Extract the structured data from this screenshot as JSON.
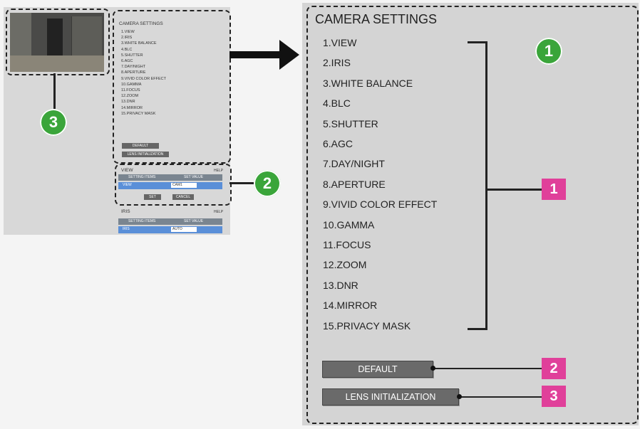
{
  "small_panel": {
    "title": "CAMERA SETTINGS",
    "menu_items": [
      "1.VIEW",
      "2.IRIS",
      "3.WHITE BALANCE",
      "4.BLC",
      "5.SHUTTER",
      "6.AGC",
      "7.DAY/NIGHT",
      "8.APERTURE",
      "9.VIVID COLOR EFFECT",
      "10.GAMMA",
      "11.FOCUS",
      "12.ZOOM",
      "13.DNR",
      "14.MIRROR",
      "15.PRIVACY MASK"
    ],
    "default_label": "DEFAULT",
    "lens_init_label": "LENS INITIALIZATION",
    "view_section": {
      "title": "VIEW",
      "help": "HELP",
      "col_item": "SETTING ITEMS",
      "col_value": "SET VALUE",
      "row_label": "VIEW",
      "row_value": "CAM1",
      "set_label": "SET",
      "cancel_label": "CANCEL"
    },
    "iris_section": {
      "title": "IRIS",
      "help": "HELP",
      "col_item": "SETTING ITEMS",
      "col_value": "SET VALUE",
      "row_label": "IRIS",
      "row_value": "AUTO"
    }
  },
  "big_panel": {
    "title": "CAMERA SETTINGS",
    "menu_items": [
      "1.VIEW",
      "2.IRIS",
      "3.WHITE BALANCE",
      "4.BLC",
      "5.SHUTTER",
      "6.AGC",
      "7.DAY/NIGHT",
      "8.APERTURE",
      "9.VIVID COLOR EFFECT",
      "10.GAMMA",
      "11.FOCUS",
      "12.ZOOM",
      "13.DNR",
      "14.MIRROR",
      "15.PRIVACY MASK"
    ],
    "default_label": "DEFAULT",
    "lens_init_label": "LENS INITIALIZATION"
  },
  "callouts": {
    "green_1": "1",
    "green_2": "2",
    "green_3": "3",
    "pink_1": "1",
    "pink_2": "2",
    "pink_3": "3"
  },
  "colors": {
    "green_badge": "#3aa53a",
    "pink_badge": "#e0409a",
    "panel_bg": "#d4d4d4",
    "button_bg": "#6a6a6a",
    "row_highlight": "#5a8fd8"
  }
}
